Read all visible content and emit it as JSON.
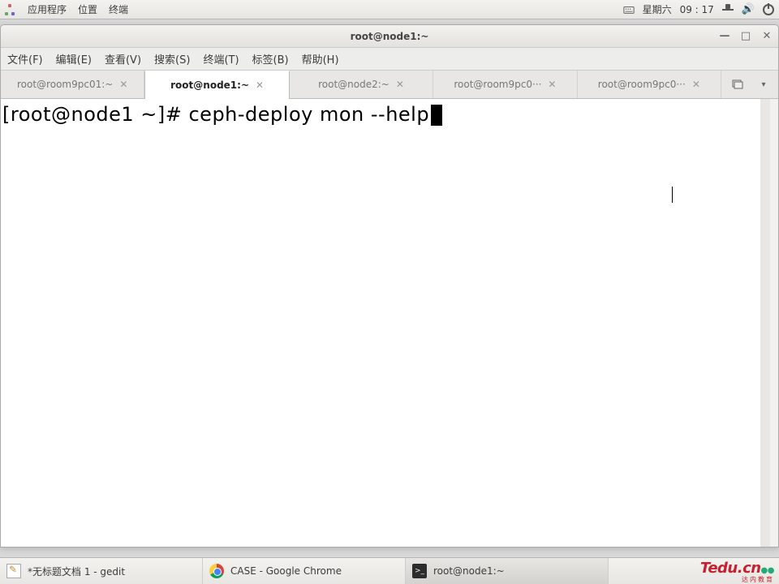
{
  "top_panel": {
    "apps": "应用程序",
    "places": "位置",
    "terminal": "终端",
    "day": "星期六",
    "time": "09 : 17"
  },
  "window": {
    "title": "root@node1:~"
  },
  "menu": {
    "file": "文件(F)",
    "edit": "编辑(E)",
    "view": "查看(V)",
    "search": "搜索(S)",
    "terminal": "终端(T)",
    "tabs": "标签(B)",
    "help": "帮助(H)"
  },
  "tabs": [
    {
      "label": "root@room9pc01:~",
      "active": false
    },
    {
      "label": "root@node1:~",
      "active": true
    },
    {
      "label": "root@node2:~",
      "active": false
    },
    {
      "label": "root@room9pc0···",
      "active": false
    },
    {
      "label": "root@room9pc0···",
      "active": false
    }
  ],
  "terminal": {
    "prompt": "[root@node1 ~]# ",
    "command": "ceph-deploy mon --help"
  },
  "taskbar": [
    {
      "label": "*无标题文档 1 - gedit",
      "icon": "gedit"
    },
    {
      "label": "CASE - Google Chrome",
      "icon": "chrome"
    },
    {
      "label": "root@node1:~",
      "icon": "term",
      "active": true
    }
  ],
  "watermark": {
    "logo": "Tedu.cn",
    "sub": "达内教育"
  }
}
